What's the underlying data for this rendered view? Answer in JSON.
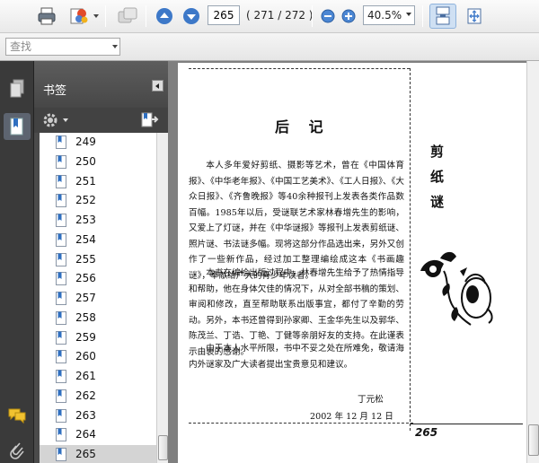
{
  "toolbar": {
    "current_page": "265",
    "page_total": "( 271 / 272 )",
    "zoom": "40.5%"
  },
  "findbar": {
    "placeholder": "查找"
  },
  "bookmarks_panel": {
    "title": "书签",
    "items": [
      {
        "label": "249"
      },
      {
        "label": "250"
      },
      {
        "label": "251"
      },
      {
        "label": "252"
      },
      {
        "label": "253"
      },
      {
        "label": "254"
      },
      {
        "label": "255"
      },
      {
        "label": "256"
      },
      {
        "label": "257"
      },
      {
        "label": "258"
      },
      {
        "label": "259"
      },
      {
        "label": "260"
      },
      {
        "label": "261"
      },
      {
        "label": "262"
      },
      {
        "label": "263"
      },
      {
        "label": "264"
      },
      {
        "label": "265"
      }
    ],
    "selected": "265"
  },
  "document": {
    "heading": "后 记",
    "paragraphs": [
      "本人多年爱好剪纸、摄影等艺术，曾在《中国体育报》、《中华老年报》、《中国工艺美术》、《工人日报》、《大众日报》、《齐鲁晚报》等40余种报刊上发表各类作品数百幅。1985年以后，受谜联艺术家林春增先生的影响，又爱上了灯谜，并在《中华谜报》等报刊上发表剪纸谜、照片谜、书法谜多幅。现将这部分作品选出来，另外又创作了一些新作品，经过加工整理编绘成这本《书画趣谜》，奉献给广大的青少年读者。",
      "本书在编绘出版过程中，林春增先生给予了热情指导和帮助，他在身体欠佳的情况下，从对全部书稿的策划、审阅和修改，直至帮助联系出版事宜，都付了辛勤的劳动。另外，本书还曾得到孙家卿、王金华先生以及郭华、陈茂兰、丁诰、丁艳、丁健等亲朋好友的支持。在此谨表示由衷的感谢。",
      "由于本人水平所限，书中不妥之处在所难免，敬请海内外谜家及广大读者提出宝贵意见和建议。"
    ],
    "author": "丁元松",
    "date": "2002 年 12 月 12 日",
    "side_title": [
      "剪",
      "纸",
      "谜"
    ],
    "page_number": "265"
  }
}
